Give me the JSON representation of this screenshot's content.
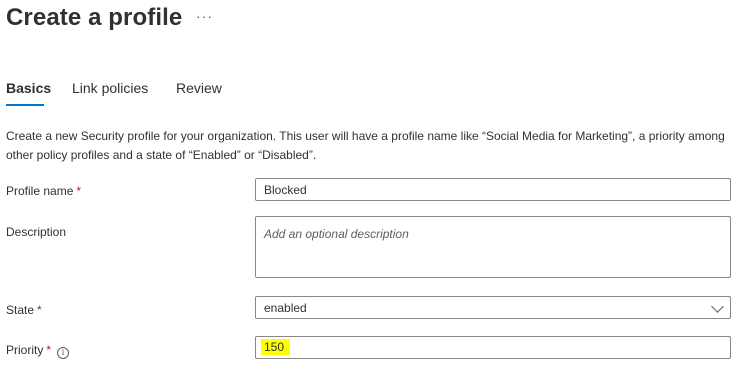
{
  "header": {
    "title": "Create a profile",
    "more_label": "···"
  },
  "tabs": [
    {
      "label": "Basics",
      "active": true
    },
    {
      "label": "Link policies",
      "active": false
    },
    {
      "label": "Review",
      "active": false
    }
  ],
  "intro_text": "Create a new Security profile for your organization. This user will have a profile name like “Social Media for Marketing”, a priority among other policy profiles and a state of “Enabled” or “Disabled”.",
  "form": {
    "profile_name": {
      "label": "Profile name",
      "required_marker": "*",
      "value": "Blocked"
    },
    "description": {
      "label": "Description",
      "placeholder": "Add an optional description",
      "value": ""
    },
    "state": {
      "label": "State",
      "required_marker": "*",
      "value": "enabled"
    },
    "priority": {
      "label": "Priority",
      "required_marker": "*",
      "info_icon": "i",
      "value": "150",
      "highlight_color": "#ffff00"
    }
  },
  "colors": {
    "accent": "#0078d4",
    "required": "#a4262c",
    "text": "#323130",
    "border": "#8a8886"
  },
  "icons": {
    "more": "more-ellipsis-icon",
    "chevron": "chevron-down-icon",
    "info": "info-icon"
  }
}
